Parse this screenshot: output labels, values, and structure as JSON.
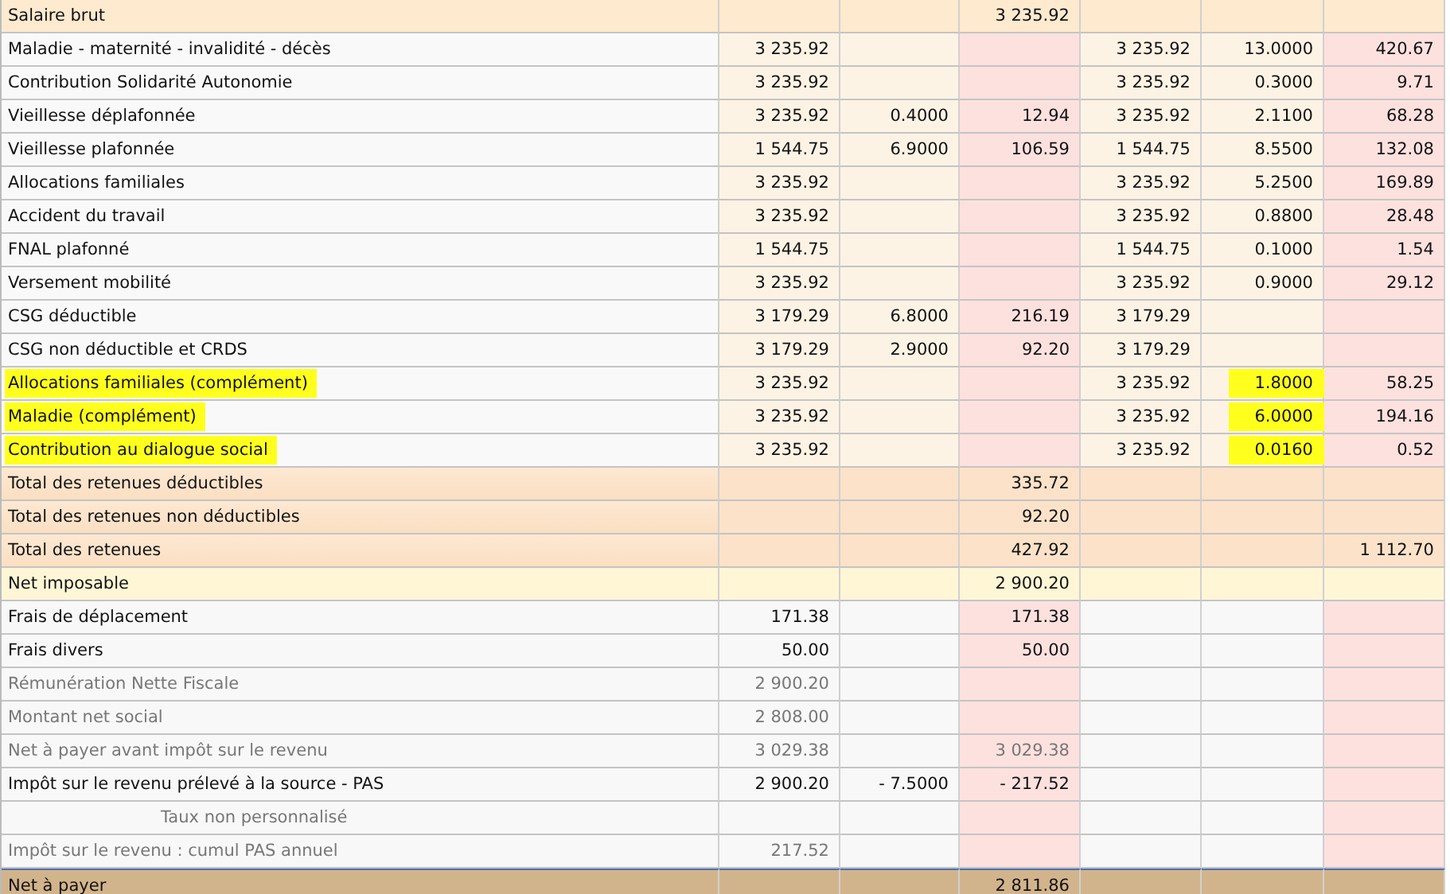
{
  "rows": [
    {
      "kind": "header",
      "label": "Salaire brut",
      "muted": false,
      "highlighted": false,
      "cells": [
        "",
        "",
        "3 235.92",
        "",
        "",
        ""
      ]
    },
    {
      "kind": "line",
      "label": "Maladie - maternité - invalidité - décès",
      "muted": false,
      "highlighted": false,
      "cells": [
        "3 235.92",
        "",
        "",
        "3 235.92",
        "13.0000",
        "420.67"
      ]
    },
    {
      "kind": "line",
      "label": "Contribution Solidarité Autonomie",
      "muted": false,
      "highlighted": false,
      "cells": [
        "3 235.92",
        "",
        "",
        "3 235.92",
        "0.3000",
        "9.71"
      ]
    },
    {
      "kind": "line",
      "label": "Vieillesse déplafonnée",
      "muted": false,
      "highlighted": false,
      "cells": [
        "3 235.92",
        "0.4000",
        "12.94",
        "3 235.92",
        "2.1100",
        "68.28"
      ]
    },
    {
      "kind": "line",
      "label": "Vieillesse plafonnée",
      "muted": false,
      "highlighted": false,
      "cells": [
        "1 544.75",
        "6.9000",
        "106.59",
        "1 544.75",
        "8.5500",
        "132.08"
      ]
    },
    {
      "kind": "line",
      "label": "Allocations familiales",
      "muted": false,
      "highlighted": false,
      "cells": [
        "3 235.92",
        "",
        "",
        "3 235.92",
        "5.2500",
        "169.89"
      ]
    },
    {
      "kind": "line",
      "label": "Accident du travail",
      "muted": false,
      "highlighted": false,
      "cells": [
        "3 235.92",
        "",
        "",
        "3 235.92",
        "0.8800",
        "28.48"
      ]
    },
    {
      "kind": "line",
      "label": "FNAL plafonné",
      "muted": false,
      "highlighted": false,
      "cells": [
        "1 544.75",
        "",
        "",
        "1 544.75",
        "0.1000",
        "1.54"
      ]
    },
    {
      "kind": "line",
      "label": "Versement mobilité",
      "muted": false,
      "highlighted": false,
      "cells": [
        "3 235.92",
        "",
        "",
        "3 235.92",
        "0.9000",
        "29.12"
      ]
    },
    {
      "kind": "line",
      "label": "CSG déductible",
      "muted": false,
      "highlighted": false,
      "cells": [
        "3 179.29",
        "6.8000",
        "216.19",
        "3 179.29",
        "",
        ""
      ]
    },
    {
      "kind": "line",
      "label": "CSG non déductible et CRDS",
      "muted": false,
      "highlighted": false,
      "cells": [
        "3 179.29",
        "2.9000",
        "92.20",
        "3 179.29",
        "",
        ""
      ]
    },
    {
      "kind": "line",
      "label": "Allocations familiales (complément)",
      "muted": false,
      "highlighted": true,
      "cells": [
        "3 235.92",
        "",
        "",
        "3 235.92",
        "1.8000",
        "58.25"
      ]
    },
    {
      "kind": "line",
      "label": "Maladie (complément)",
      "muted": false,
      "highlighted": true,
      "cells": [
        "3 235.92",
        "",
        "",
        "3 235.92",
        "6.0000",
        "194.16"
      ]
    },
    {
      "kind": "line",
      "label": "Contribution au dialogue social",
      "muted": false,
      "highlighted": true,
      "cells": [
        "3 235.92",
        "",
        "",
        "3 235.92",
        "0.0160",
        "0.52"
      ]
    },
    {
      "kind": "total",
      "label": "Total des retenues déductibles",
      "muted": false,
      "highlighted": false,
      "cells": [
        "",
        "",
        "335.72",
        "",
        "",
        ""
      ]
    },
    {
      "kind": "total",
      "label": "Total des retenues non déductibles",
      "muted": false,
      "highlighted": false,
      "cells": [
        "",
        "",
        "92.20",
        "",
        "",
        ""
      ]
    },
    {
      "kind": "total",
      "label": "Total des retenues",
      "muted": false,
      "highlighted": false,
      "cells": [
        "",
        "",
        "427.92",
        "",
        "",
        "1 112.70"
      ]
    },
    {
      "kind": "net",
      "label": "Net imposable",
      "muted": false,
      "highlighted": false,
      "cells": [
        "",
        "",
        "2 900.20",
        "",
        "",
        ""
      ]
    },
    {
      "kind": "other",
      "label": "Frais de déplacement",
      "muted": false,
      "highlighted": false,
      "cells": [
        "171.38",
        "",
        "171.38",
        "",
        "",
        ""
      ]
    },
    {
      "kind": "other",
      "label": "Frais divers",
      "muted": false,
      "highlighted": false,
      "cells": [
        "50.00",
        "",
        "50.00",
        "",
        "",
        ""
      ]
    },
    {
      "kind": "other",
      "label": "Rémunération Nette Fiscale",
      "muted": true,
      "highlighted": false,
      "cells": [
        "2 900.20",
        "",
        "",
        "",
        "",
        ""
      ]
    },
    {
      "kind": "other",
      "label": "Montant net social",
      "muted": true,
      "highlighted": false,
      "cells": [
        "2 808.00",
        "",
        "",
        "",
        "",
        ""
      ]
    },
    {
      "kind": "other",
      "label": "Net à payer avant impôt sur le revenu",
      "muted": true,
      "highlighted": false,
      "cells": [
        "3 029.38",
        "",
        "3 029.38",
        "",
        "",
        ""
      ]
    },
    {
      "kind": "other",
      "label": "Impôt sur le revenu prélevé à la source - PAS",
      "muted": false,
      "highlighted": false,
      "cells": [
        "2 900.20",
        "- 7.5000",
        "- 217.52",
        "",
        "",
        ""
      ]
    },
    {
      "kind": "sub",
      "label": "Taux non personnalisé",
      "muted": true,
      "highlighted": false,
      "cells": [
        "",
        "",
        "",
        "",
        "",
        ""
      ]
    },
    {
      "kind": "other",
      "label": "Impôt sur le revenu : cumul PAS annuel",
      "muted": true,
      "highlighted": false,
      "cells": [
        "217.52",
        "",
        "",
        "",
        "",
        ""
      ]
    },
    {
      "kind": "final",
      "label": "Net à payer",
      "muted": false,
      "highlighted": false,
      "cells": [
        "",
        "",
        "2 811.86",
        "",
        "",
        ""
      ]
    }
  ]
}
